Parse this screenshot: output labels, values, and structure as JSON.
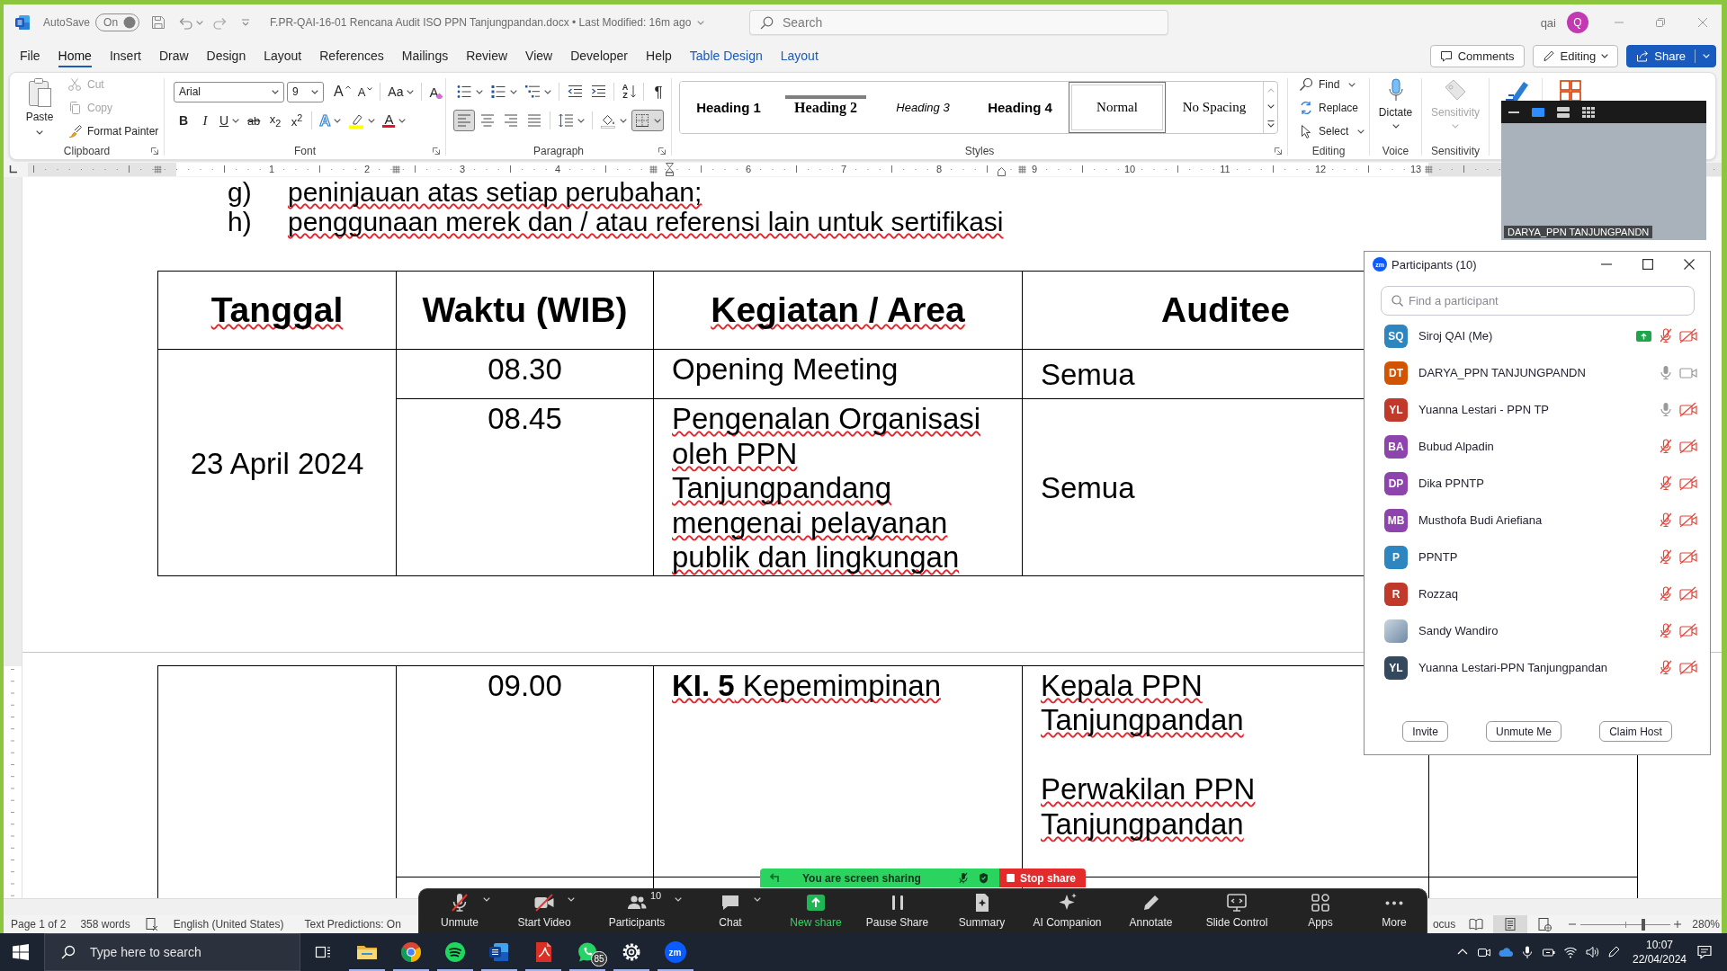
{
  "word": {
    "titlebar": {
      "autosave_label": "AutoSave",
      "autosave": {
        "text": "On",
        "on": true
      },
      "document_title": "F.PR-QAI-16-01 Rencana Audit ISO PPN Tanjungpandan.docx • Last Modified: 16m ago",
      "search": {
        "placeholder": "Search"
      },
      "user": "qai",
      "avatar": "Q"
    },
    "menu_tabs": [
      {
        "label": "File",
        "kind": "plain",
        "selected": false
      },
      {
        "label": "Home",
        "kind": "plain",
        "selected": true
      },
      {
        "label": "Insert",
        "kind": "plain",
        "selected": false
      },
      {
        "label": "Draw",
        "kind": "plain",
        "selected": false
      },
      {
        "label": "Design",
        "kind": "plain",
        "selected": false
      },
      {
        "label": "Layout",
        "kind": "plain",
        "selected": false
      },
      {
        "label": "References",
        "kind": "plain",
        "selected": false
      },
      {
        "label": "Mailings",
        "kind": "plain",
        "selected": false
      },
      {
        "label": "Review",
        "kind": "plain",
        "selected": false
      },
      {
        "label": "View",
        "kind": "plain",
        "selected": false
      },
      {
        "label": "Developer",
        "kind": "plain",
        "selected": false
      },
      {
        "label": "Help",
        "kind": "plain",
        "selected": false
      },
      {
        "label": "Table Design",
        "kind": "contextual",
        "selected": false
      },
      {
        "label": "Layout",
        "kind": "contextual",
        "selected": false
      }
    ],
    "actions": [
      {
        "label": "Comments",
        "kind": "comments"
      },
      {
        "label": "Editing",
        "kind": "mode"
      },
      {
        "label": "Share",
        "kind": "share"
      }
    ],
    "ribbon": {
      "clipboard": {
        "label": "Clipboard",
        "paste": "Paste",
        "items": [
          {
            "kind": "cut",
            "label": "Cut",
            "disabled": true
          },
          {
            "kind": "copy",
            "label": "Copy",
            "disabled": true
          },
          {
            "kind": "painter",
            "label": "Format Painter",
            "disabled": false
          }
        ]
      },
      "font": {
        "label": "Font",
        "font_name": "Arial",
        "font_size": "9",
        "row_1": [
          {
            "kind": "grow",
            "glyph": "A",
            "menu": false
          },
          {
            "kind": "shrink",
            "glyph": "A",
            "menu": false
          },
          {
            "kind": "case",
            "glyph": "Aa",
            "menu": true
          },
          {
            "kind": "clear",
            "glyph": "A",
            "menu": false
          }
        ],
        "row_2": [
          {
            "kind": "bold",
            "glyph": "B",
            "menu": false
          },
          {
            "kind": "italic",
            "glyph": "I",
            "menu": false
          },
          {
            "kind": "underline",
            "glyph": "U",
            "menu": true
          },
          {
            "kind": "strike",
            "glyph": "ab",
            "menu": false
          },
          {
            "kind": "subscript",
            "glyph": "x$_{2}$",
            "menu": false
          },
          {
            "kind": "superscript",
            "glyph": "x$^{2}$",
            "menu": false
          },
          {
            "kind": "effects",
            "glyph": "A",
            "menu": true
          },
          {
            "kind": "highlight",
            "menu": true
          },
          {
            "kind": "color",
            "glyph": "A",
            "menu": true
          }
        ]
      },
      "paragraph": {
        "label": "Paragraph",
        "row_1": [
          {
            "kind": "bullets",
            "menu": true,
            "selected": false
          },
          {
            "kind": "numbering",
            "menu": true,
            "selected": false
          },
          {
            "kind": "multilevel",
            "menu": true,
            "selected": false
          },
          {
            "kind": "outdent",
            "menu": false,
            "selected": false
          },
          {
            "kind": "indent",
            "menu": false,
            "selected": false
          },
          {
            "kind": "sort",
            "glyph": "AZ",
            "menu": false,
            "selected": false
          },
          {
            "kind": "marks",
            "glyph": "¶",
            "menu": false,
            "selected": false
          }
        ],
        "row_2": [
          {
            "kind": "left",
            "menu": false,
            "selected": true
          },
          {
            "kind": "center",
            "menu": false,
            "selected": false
          },
          {
            "kind": "right",
            "menu": false,
            "selected": false
          },
          {
            "kind": "justify",
            "menu": false,
            "selected": false
          },
          {
            "kind": "spacing",
            "menu": true,
            "selected": false
          },
          {
            "kind": "shading",
            "menu": true,
            "selected": false
          },
          {
            "kind": "borders",
            "menu": true,
            "selected": true
          }
        ]
      },
      "styles": {
        "label": "Styles",
        "items": [
          {
            "label": "Heading 1",
            "kind": "sansbold",
            "rule_above": false,
            "selected": false
          },
          {
            "label": "Heading 2",
            "kind": "serifbold",
            "rule_above": true,
            "selected": false
          },
          {
            "label": "Heading 3",
            "kind": "sansitalic",
            "rule_above": false,
            "selected": false
          },
          {
            "label": "Heading 4",
            "kind": "sansbold",
            "rule_above": false,
            "selected": false
          },
          {
            "label": "Normal",
            "kind": "serif",
            "rule_above": false,
            "selected": true
          },
          {
            "label": "No Spacing",
            "kind": "serif",
            "rule_above": false,
            "selected": false
          }
        ]
      },
      "editing": {
        "label": "Editing",
        "items": [
          {
            "kind": "find",
            "label": "Find",
            "menu": true
          },
          {
            "kind": "replace",
            "label": "Replace",
            "menu": false
          },
          {
            "kind": "select",
            "label": "Select",
            "menu": true
          }
        ]
      },
      "voice": {
        "label": "Voice",
        "button": "Dictate"
      },
      "sensitivity": {
        "label": "Sensitivity",
        "button": "Sensitivity",
        "disabled": true
      }
    },
    "ruler": {
      "marks": [
        {
          "kind": "number",
          "label": "1"
        },
        {
          "kind": "number",
          "label": "2"
        },
        {
          "kind": "number",
          "label": "3"
        },
        {
          "kind": "number",
          "label": "4"
        },
        {
          "kind": "indent"
        },
        {
          "kind": "number",
          "label": "6"
        },
        {
          "kind": "number",
          "label": "7"
        },
        {
          "kind": "number",
          "label": "8"
        },
        {
          "kind": "number",
          "label": "9"
        },
        {
          "kind": "number",
          "label": "10"
        },
        {
          "kind": "number",
          "label": "11"
        },
        {
          "kind": "number",
          "label": "12"
        },
        {
          "kind": "number",
          "label": "13"
        }
      ]
    },
    "document": {
      "list": [
        {
          "label": "g)",
          "text": "peninjauan atas setiap perubahan;",
          "flagged": true
        },
        {
          "label": "h)",
          "text": "penggunaan merek dan / atau referensi lain untuk sertifikasi",
          "flagged": true
        }
      ],
      "tables": [
        {
          "page_break_before": false,
          "more_rows_hidden": false,
          "columns": [
            {
              "label": "Tanggal",
              "flagged": true
            },
            {
              "label": "Waktu (WIB)",
              "flagged": false
            },
            {
              "label": "Kegiatan / Area",
              "flagged": true
            },
            {
              "label": "Auditee",
              "flagged": false
            }
          ],
          "rows": [
            {
              "date": "23 April 2024",
              "entries": [
                {
                  "time": "08.30",
                  "activity": [
                    {
                      "text": "Opening Meeting",
                      "flagged": false
                    }
                  ],
                  "auditee": [
                    {
                      "text": "Semua",
                      "flagged": false
                    }
                  ]
                },
                {
                  "time": "08.45",
                  "activity": [
                    {
                      "text": "Pengenalan Organisasi oleh PPN Tanjungpandang mengenai pelayanan publik dan lingkungan",
                      "flagged": true
                    }
                  ],
                  "auditee": [
                    {
                      "text": "Semua",
                      "flagged": false
                    }
                  ]
                }
              ]
            }
          ]
        },
        {
          "page_break_before": true,
          "more_rows_hidden": true,
          "rows": [
            {
              "entries": [
                {
                  "time": "09.00",
                  "activity": [
                    {
                      "text": "**KI. 5** Kepemimpinan",
                      "flagged": true
                    }
                  ],
                  "auditee": [
                    {
                      "text": "Kepala PPN Tanjungpandan",
                      "flagged": true
                    },
                    {
                      "text": "Perwakilan PPN Tanjungpandan",
                      "flagged": true
                    }
                  ]
                }
              ]
            }
          ]
        }
      ]
    },
    "status_bar": {
      "page": "Page 1 of 2",
      "words": "358 words",
      "language": "English (United States)",
      "text_predictions": "Text Predictions: On",
      "focus": "ocus",
      "views": [
        {
          "kind": "read",
          "selected": false
        },
        {
          "kind": "print",
          "selected": true
        },
        {
          "kind": "web",
          "selected": false
        }
      ],
      "zoom": {
        "level": 0.71,
        "reading": "280%"
      }
    }
  },
  "zoom": {
    "sharing_banner": {
      "text": "You are screen sharing",
      "stop": "Stop share"
    },
    "toolbar": [
      {
        "kind": "audio",
        "label": "Unmute",
        "muted": true,
        "menu": true
      },
      {
        "kind": "video",
        "label": "Start Video",
        "video_on": false,
        "menu": true
      },
      {
        "kind": "participants",
        "label": "Participants",
        "count": "10",
        "menu": true
      },
      {
        "kind": "chat",
        "label": "Chat",
        "menu": true
      },
      {
        "kind": "share",
        "label": "New share",
        "menu": false
      },
      {
        "kind": "pause",
        "label": "Pause Share",
        "menu": false
      },
      {
        "kind": "summary",
        "label": "Summary",
        "menu": false
      },
      {
        "kind": "companion",
        "label": "AI Companion",
        "menu": false
      },
      {
        "kind": "annotate",
        "label": "Annotate",
        "menu": false
      },
      {
        "kind": "slides",
        "label": "Slide Control",
        "menu": false
      },
      {
        "kind": "apps",
        "label": "Apps",
        "menu": false
      },
      {
        "kind": "more",
        "label": "More",
        "menu": false
      }
    ],
    "video": {
      "name": "DARYA_PPN TANJUNGPANDN",
      "controls": [
        {
          "kind": "minimize",
          "selected": false
        },
        {
          "kind": "speaker",
          "selected": true
        },
        {
          "kind": "strip",
          "selected": false
        },
        {
          "kind": "gallery",
          "selected": false
        }
      ]
    },
    "participants": {
      "logo": "zm",
      "title": "Participants (10)",
      "search": {
        "placeholder": "Find a participant"
      },
      "items": [
        {
          "kind": "initials",
          "initials": "SQ",
          "name": "Siroj QAI (Me)",
          "color": "#2e86c1",
          "sharing": true,
          "muted": true,
          "video_on": false
        },
        {
          "kind": "initials",
          "initials": "DT",
          "name": "DARYA_PPN TANJUNGPANDN",
          "color": "#d35400",
          "sharing": false,
          "muted": false,
          "video_on": true
        },
        {
          "kind": "initials",
          "initials": "YL",
          "name": "Yuanna Lestari - PPN TP",
          "color": "#c0392b",
          "sharing": false,
          "muted": false,
          "video_on": false
        },
        {
          "kind": "initials",
          "initials": "BA",
          "name": "Bubud Alpadin",
          "color": "#8e44ad",
          "sharing": false,
          "muted": true,
          "video_on": false
        },
        {
          "kind": "initials",
          "initials": "DP",
          "name": "Dika PPNTP",
          "color": "#8e44ad",
          "sharing": false,
          "muted": true,
          "video_on": false
        },
        {
          "kind": "initials",
          "initials": "MB",
          "name": "Musthofa Budi Ariefiana",
          "color": "#8e44ad",
          "sharing": false,
          "muted": true,
          "video_on": false
        },
        {
          "kind": "initials",
          "initials": "P",
          "name": "PPNTP",
          "color": "#2e86c1",
          "sharing": false,
          "muted": true,
          "video_on": false
        },
        {
          "kind": "initials",
          "initials": "R",
          "name": "Rozzaq",
          "color": "#c0392b",
          "sharing": false,
          "muted": true,
          "video_on": false
        },
        {
          "kind": "photo",
          "name": "Sandy Wandiro",
          "sharing": false,
          "muted": true,
          "video_on": false
        },
        {
          "kind": "initials",
          "initials": "YL",
          "name": "Yuanna Lestari-PPN Tanjungpandan",
          "color": "#34495e",
          "sharing": false,
          "muted": true,
          "video_on": false
        }
      ],
      "buttons": [
        "Invite",
        "Unmute Me",
        "Claim Host"
      ]
    }
  },
  "taskbar": {
    "search": {
      "placeholder": "Type here to search"
    },
    "apps": [
      {
        "kind": "explorer",
        "running": true
      },
      {
        "kind": "chrome",
        "running": true
      },
      {
        "kind": "spotify",
        "running": true
      },
      {
        "kind": "word",
        "running": true
      },
      {
        "kind": "pdf",
        "running": true
      },
      {
        "kind": "whatsapp",
        "badge": "85",
        "running": true
      },
      {
        "kind": "settings",
        "running": true
      },
      {
        "kind": "zoom",
        "logo": "zm",
        "running": true
      }
    ],
    "clock": {
      "time": "10:07",
      "date": "22/04/2024"
    }
  }
}
